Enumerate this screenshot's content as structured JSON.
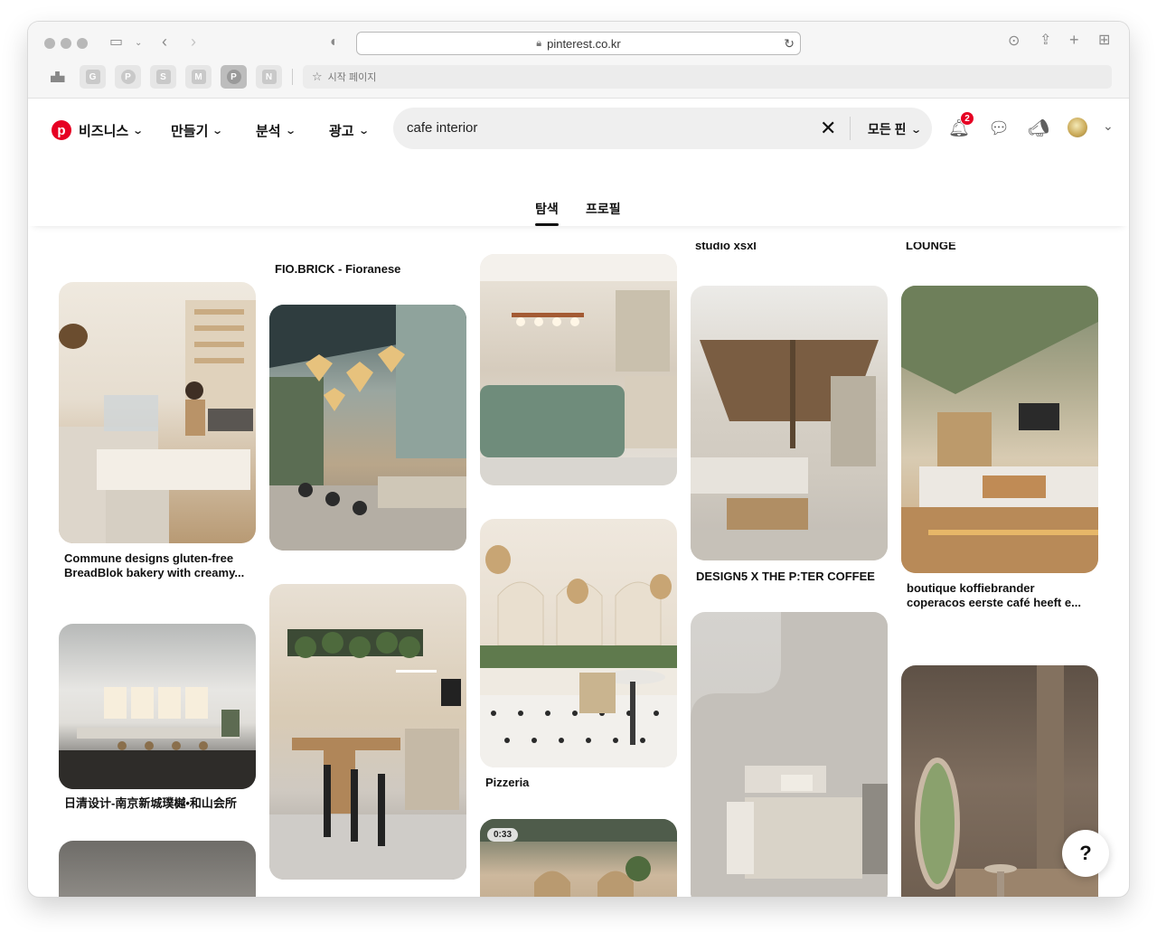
{
  "browser": {
    "url": "pinterest.co.kr",
    "start_page_label": "시작 페이지",
    "favorites": [
      "G",
      "P",
      "S",
      "M",
      "P",
      "N"
    ]
  },
  "header": {
    "nav": [
      {
        "label": "비즈니스"
      },
      {
        "label": "만들기"
      },
      {
        "label": "분석"
      },
      {
        "label": "광고"
      }
    ],
    "search": {
      "query": "cafe interior",
      "filter_label": "모든 핀"
    },
    "notification_count": "2"
  },
  "tabs": [
    {
      "label": "탐색",
      "active": true
    },
    {
      "label": "프로필",
      "active": false
    }
  ],
  "pins": {
    "top_captions": {
      "col2": "FIO.BRICK - Fioranese",
      "col4": "studio xsxl",
      "col5": "LOUNGE"
    },
    "col1": [
      {
        "caption": "Commune designs gluten-free BreadBlok bakery with creamy..."
      },
      {
        "caption": "日清设计-南京新城璞樾•和山会所"
      }
    ],
    "col3": [
      {
        "caption": "Pizzeria"
      },
      {
        "video_duration": "0:33"
      }
    ],
    "col4": [
      {
        "caption": "DESIGN5 X THE P:TER COFFEE"
      }
    ],
    "col5": [
      {
        "caption": "boutique koffiebrander coperacos eerste café heeft e..."
      }
    ]
  },
  "help_label": "?",
  "colors": {
    "brand": "#e60023"
  }
}
